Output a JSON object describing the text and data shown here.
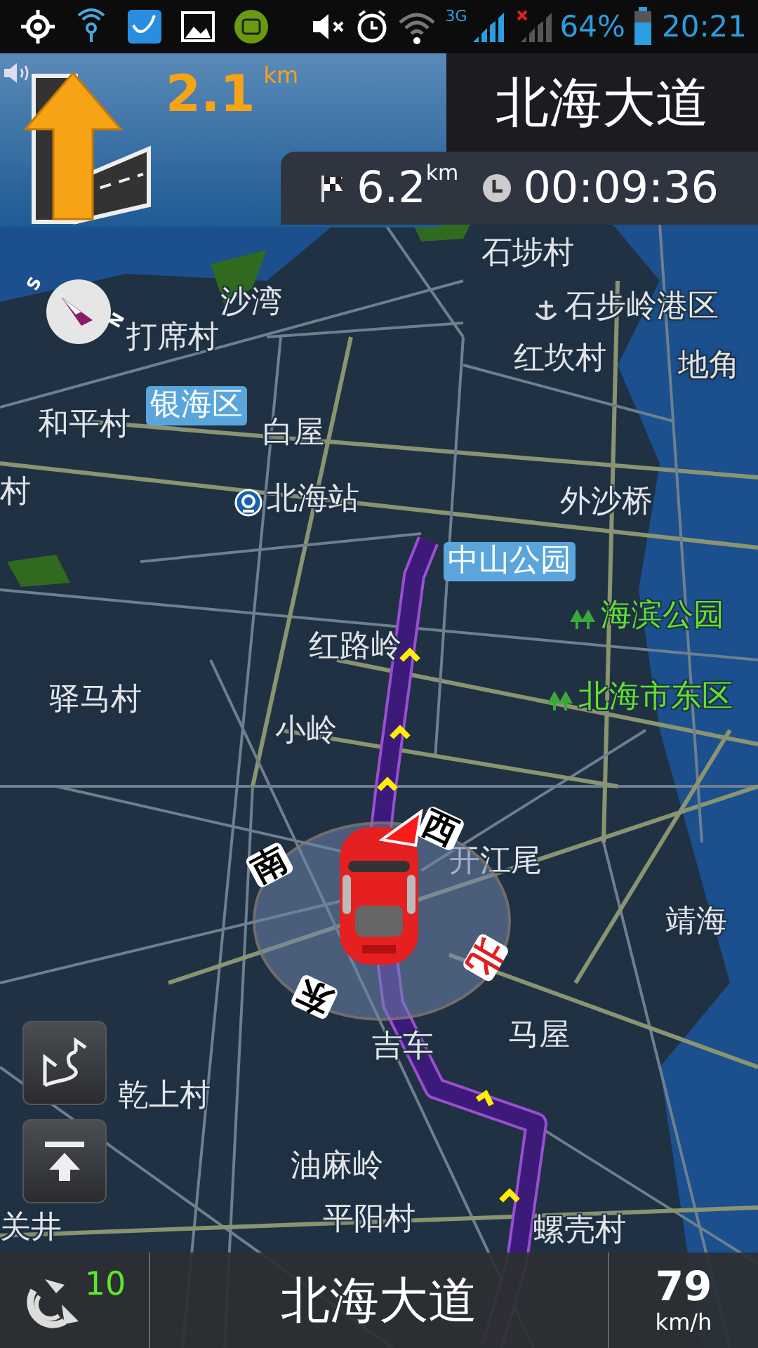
{
  "status_bar": {
    "network": "3G",
    "battery": "64%",
    "time": "20:21"
  },
  "guidance": {
    "distance": "2.1",
    "distance_unit": "km",
    "street": "北海大道",
    "remaining_distance": "6.2",
    "remaining_unit": "km",
    "remaining_time": "00:09:36"
  },
  "map": {
    "compass": [
      "S",
      "N"
    ],
    "labels": [
      {
        "text": "石埗村",
        "kind": "place"
      },
      {
        "text": "沙湾",
        "kind": "place"
      },
      {
        "text": "石步岭港区",
        "kind": "harbor"
      },
      {
        "text": "打席村",
        "kind": "place"
      },
      {
        "text": "红坎村",
        "kind": "place"
      },
      {
        "text": "地角",
        "kind": "place"
      },
      {
        "text": "银海区",
        "kind": "district"
      },
      {
        "text": "和平村",
        "kind": "place"
      },
      {
        "text": "白屋",
        "kind": "place"
      },
      {
        "text": "村",
        "kind": "place"
      },
      {
        "text": "北海站",
        "kind": "station"
      },
      {
        "text": "外沙桥",
        "kind": "place"
      },
      {
        "text": "中山公园",
        "kind": "district"
      },
      {
        "text": "海滨公园",
        "kind": "park"
      },
      {
        "text": "红路岭",
        "kind": "place"
      },
      {
        "text": "北海市东区",
        "kind": "park"
      },
      {
        "text": "驿马村",
        "kind": "place"
      },
      {
        "text": "小岭",
        "kind": "place"
      },
      {
        "text": "开江尾",
        "kind": "place"
      },
      {
        "text": "靖海",
        "kind": "place"
      },
      {
        "text": "马屋",
        "kind": "place"
      },
      {
        "text": "吉车",
        "kind": "place"
      },
      {
        "text": "乾上村",
        "kind": "place"
      },
      {
        "text": "油麻岭",
        "kind": "place"
      },
      {
        "text": "关井",
        "kind": "place"
      },
      {
        "text": "平阳村",
        "kind": "place"
      },
      {
        "text": "螺壳村",
        "kind": "place"
      }
    ],
    "car_compass": [
      {
        "text": "西",
        "color": "#000000"
      },
      {
        "text": "南",
        "color": "#000000"
      },
      {
        "text": "东",
        "color": "#000000"
      },
      {
        "text": "北",
        "color": "#e02020"
      }
    ]
  },
  "bottom_bar": {
    "satellites": "10",
    "street": "北海大道",
    "speed": "79",
    "speed_unit": "km/h"
  }
}
